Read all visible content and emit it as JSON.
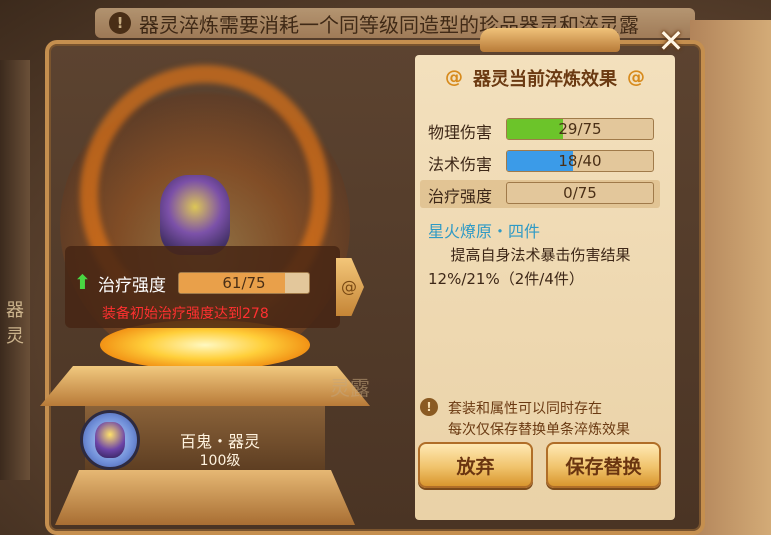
{
  "top_hint": "器灵淬炼需要消耗一个同等级同造型的珍品器灵和淬灵露",
  "background": {
    "left_label": "器灵",
    "ghost_label": "灵露"
  },
  "close_label": "✕",
  "callout": {
    "stat_label": "治疗强度",
    "bar": {
      "text": "61/75",
      "value": 61,
      "max": 75
    },
    "requirement": "装备初始治疗强度达到278"
  },
  "spirit": {
    "name": "百鬼・器灵",
    "level": "100级"
  },
  "panel": {
    "title": "器灵当前淬炼效果",
    "stats": [
      {
        "label": "物理伤害",
        "text": "29/75",
        "value": 29,
        "max": 75,
        "color": "#6cc42a"
      },
      {
        "label": "法术伤害",
        "text": "18/40",
        "value": 18,
        "max": 40,
        "color": "#3b9be8"
      },
      {
        "label": "治疗强度",
        "text": "0/75",
        "value": 0,
        "max": 75,
        "color": "#e8a84a"
      }
    ],
    "set_title": "星火燎原・四件",
    "set_desc": "提高自身法术暴击伤害结果12%/21%（2件/4件）",
    "notice_lines": [
      "套装和属性可以同时存在",
      "每次仅保存替换单条淬炼效果"
    ]
  },
  "buttons": {
    "discard": "放弃",
    "save_replace": "保存替换"
  },
  "colors": {
    "callout_bar_fill": "#e9a04a",
    "accent": "#d78a1c"
  }
}
